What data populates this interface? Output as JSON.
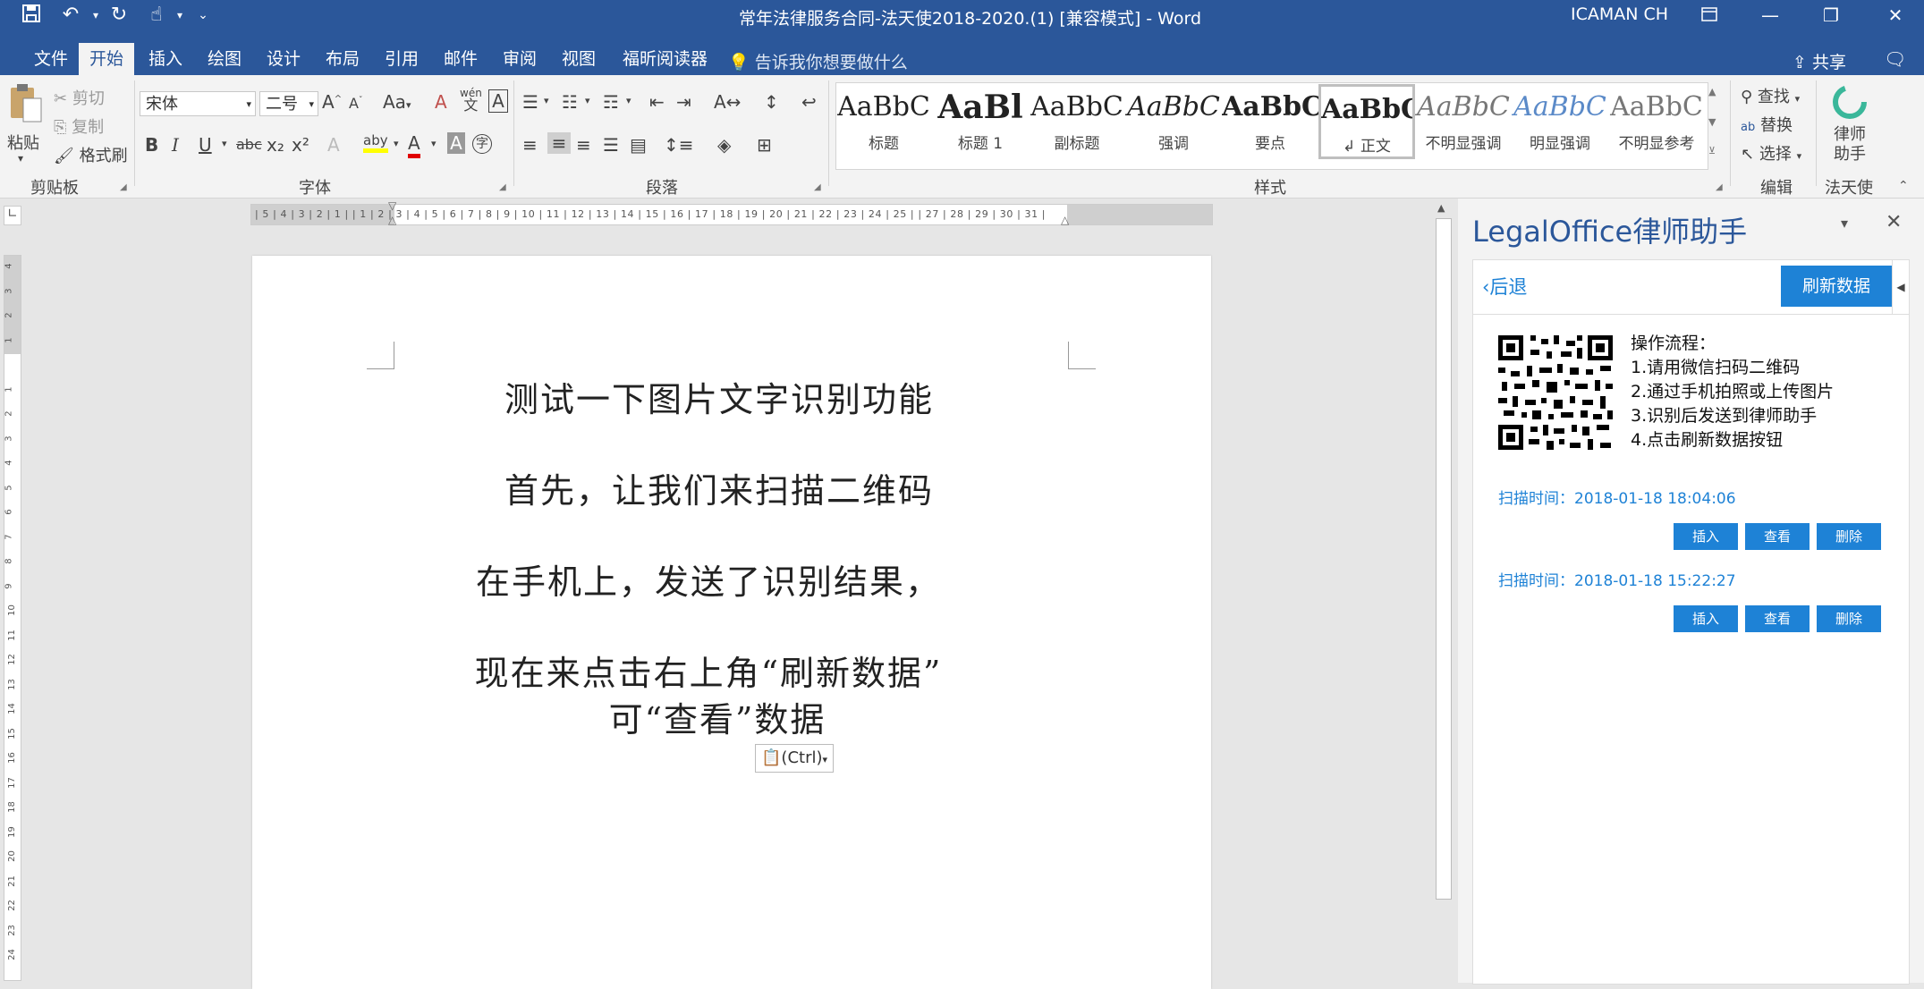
{
  "titlebar": {
    "title": "常年法律服务合同-法天使2018-2020.(1) [兼容模式]  -  Word",
    "user": "ICAMAN CH"
  },
  "tabs": [
    "文件",
    "开始",
    "插入",
    "绘图",
    "设计",
    "布局",
    "引用",
    "邮件",
    "审阅",
    "视图",
    "福昕阅读器"
  ],
  "active_tab": "开始",
  "tell_me": "告诉我你想要做什么",
  "share": "共享",
  "clipboard": {
    "paste": "粘贴",
    "cut": "剪切",
    "copy": "复制",
    "format_painter": "格式刷",
    "group": "剪贴板"
  },
  "font": {
    "name": "宋体",
    "size": "二号",
    "group": "字体",
    "change_case": "Aa",
    "wen": "wén",
    "wen_char": "文",
    "grow": "A",
    "shrink": "A",
    "clear": "A",
    "border_char": "A",
    "bold": "B",
    "italic": "I",
    "underline": "U",
    "strike": "abc",
    "sub": "x₂",
    "sup": "x²",
    "effect": "A",
    "highlight": "aby",
    "color": "A",
    "shade": "A",
    "circle": "字"
  },
  "paragraph": {
    "group": "段落"
  },
  "styles": {
    "group": "样式",
    "items": [
      {
        "sample": "AaBbC",
        "label": "标题"
      },
      {
        "sample": "AaBl",
        "label": "标题 1"
      },
      {
        "sample": "AaBbC",
        "label": "副标题"
      },
      {
        "sample": "AaBbC",
        "label": "强调"
      },
      {
        "sample": "AaBbC",
        "label": "要点"
      },
      {
        "sample": "AaBbC",
        "label": "↲ 正文"
      },
      {
        "sample": "AaBbC",
        "label": "不明显强调"
      },
      {
        "sample": "AaBbC",
        "label": "明显强调"
      },
      {
        "sample": "AaBbC",
        "label": "不明显参考"
      }
    ]
  },
  "editing": {
    "find": "查找",
    "replace": "替换",
    "select": "选择",
    "group": "编辑"
  },
  "lawyer_addin": {
    "label": "律师助手",
    "group": "法天使"
  },
  "ruler_h": "| 5 | 4 | 3 | 2 | 1 |     | 1 | 2 | 3 | 4 | 5 | 6 | 7 | 8 | 9 | 10 | 11 | 12 | 13 | 14 | 15 | 16 | 17 | 18 | 19 | 20 | 21 | 22 | 23 | 24 | 25 |     | 27 | 28 | 29 | 30 | 31 |",
  "document": {
    "lines": [
      "测试一下图片文字识别功能",
      "首先，让我们来扫描二维码",
      "在手机上，发送了识别结果，",
      "现在来点击右上角“刷新数据”",
      "可“查看”数据"
    ],
    "paste_options": "(Ctrl)"
  },
  "pane": {
    "title": "LegalOffice律师助手",
    "back": "后退",
    "refresh": "刷新数据",
    "steps": [
      "操作流程：",
      "1.请用微信扫码二维码",
      "2.通过手机拍照或上传图片",
      "3.识别后发送到律师助手",
      "4.点击刷新数据按钮"
    ],
    "scans": [
      {
        "label": "扫描时间：2018-01-18 18:04:06",
        "insert": "插入",
        "view": "查看",
        "delete": "删除"
      },
      {
        "label": "扫描时间：2018-01-18 15:22:27",
        "insert": "插入",
        "view": "查看",
        "delete": "删除"
      }
    ]
  },
  "colors": {
    "brand": "#2b579a",
    "accent": "#1e82d6"
  }
}
